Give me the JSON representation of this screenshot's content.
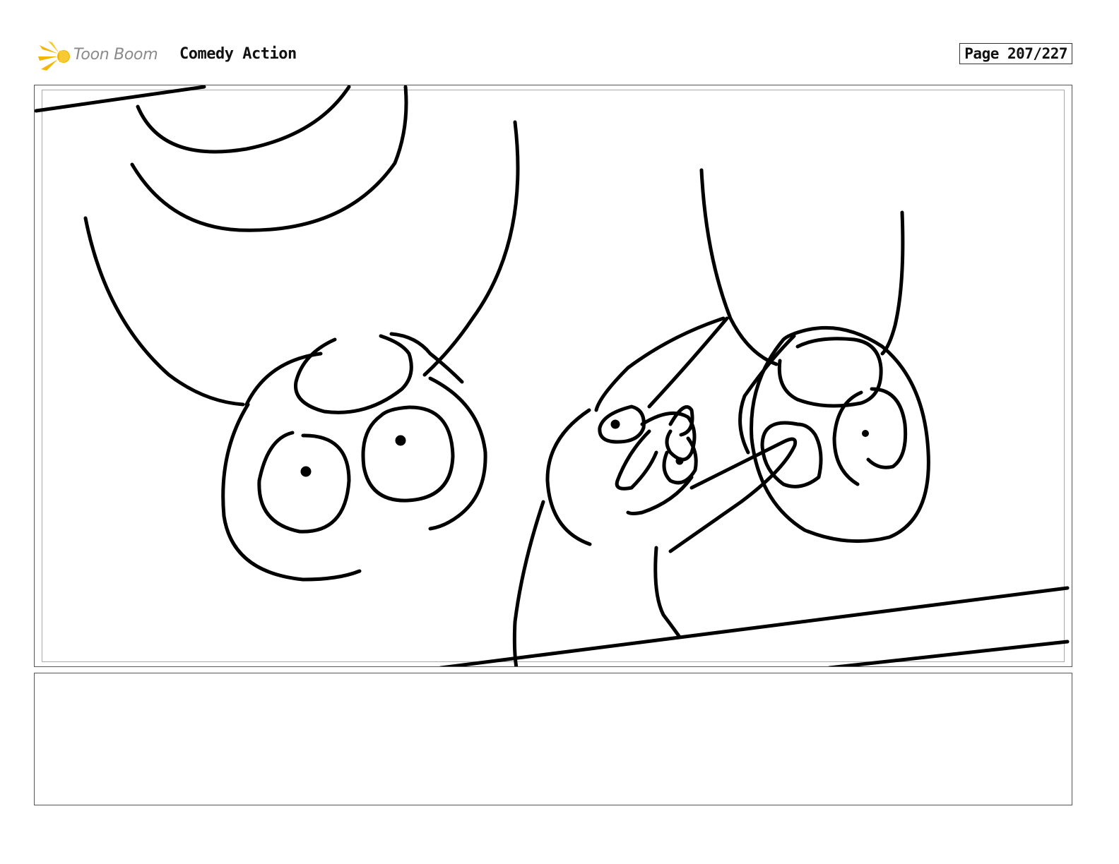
{
  "header": {
    "logo_text": "Toon Boom",
    "project_title": "Comedy Action",
    "page_label": "Page 207/227"
  },
  "colors": {
    "logo_accent": "#f2b705",
    "ink": "#000000",
    "frame": "#555555",
    "safe_frame": "#aaaaaa"
  },
  "panel": {
    "drawing": "storyboard-sketch"
  },
  "notes": {
    "text": ""
  }
}
